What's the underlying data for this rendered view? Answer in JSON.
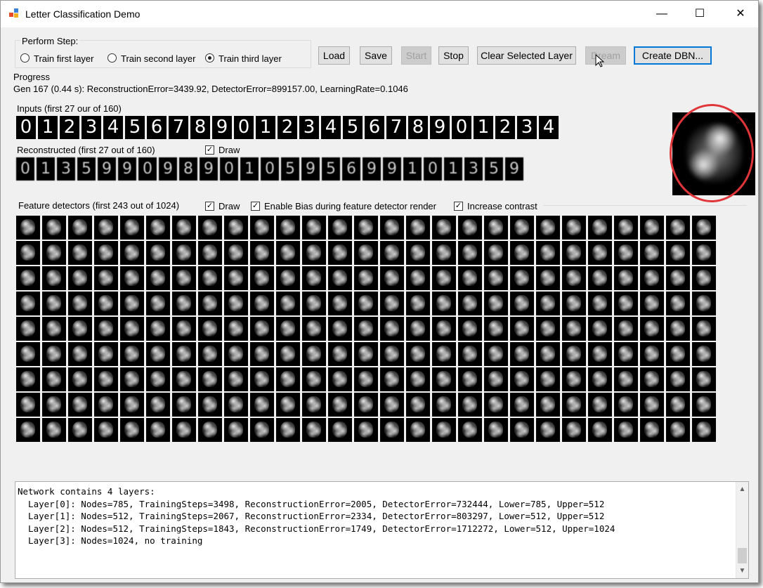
{
  "window": {
    "title": "Letter Classification Demo",
    "min_glyph": "—",
    "max_glyph": "☐",
    "close_glyph": "✕"
  },
  "perform_step": {
    "legend": "Perform Step:",
    "options": [
      {
        "label": "Train first layer",
        "selected": false
      },
      {
        "label": "Train second layer",
        "selected": false
      },
      {
        "label": "Train third layer",
        "selected": true
      }
    ]
  },
  "toolbar": {
    "load": "Load",
    "save": "Save",
    "start": "Start",
    "stop": "Stop",
    "clear_selected_layer": "Clear Selected Layer",
    "dream": "Dream",
    "create_dbn": "Create DBN..."
  },
  "progress": {
    "label": "Progress",
    "status": "Gen 167 (0.44 s): ReconstructionError=3439.92, DetectorError=899157.00, LearningRate=0.1046"
  },
  "inputs": {
    "label": "Inputs (first 27 our of 160)",
    "digits": [
      "0",
      "1",
      "2",
      "3",
      "4",
      "5",
      "6",
      "7",
      "8",
      "9",
      "0",
      "1",
      "2",
      "3",
      "4",
      "5",
      "6",
      "7",
      "8",
      "9",
      "0",
      "1",
      "2",
      "3",
      "4"
    ]
  },
  "reconstructed": {
    "label": "Reconstructed (first 27 out of 160)",
    "draw_label": "Draw",
    "draw_checked": true,
    "digits": [
      "0",
      "1",
      "3",
      "5",
      "9",
      "9",
      "0",
      "9",
      "8",
      "9",
      "0",
      "1",
      "0",
      "5",
      "9",
      "5",
      "6",
      "9",
      "9",
      "1",
      "0",
      "1",
      "3",
      "5",
      "9"
    ]
  },
  "feature_detectors": {
    "label": "Feature detectors (first 243 out of 1024)",
    "draw_label": "Draw",
    "draw_checked": true,
    "bias_label": "Enable Bias during feature detector render",
    "bias_checked": true,
    "contrast_label": "Increase contrast",
    "contrast_checked": true,
    "shown": 243
  },
  "log": {
    "lines": [
      "Network contains 4 layers:",
      "  Layer[0]: Nodes=785, TrainingSteps=3498, ReconstructionError=2005, DetectorError=732444, Lower=785, Upper=512",
      "  Layer[1]: Nodes=512, TrainingSteps=2067, ReconstructionError=2334, DetectorError=803297, Lower=512, Upper=512",
      "  Layer[2]: Nodes=512, TrainingSteps=1843, ReconstructionError=1749, DetectorError=1712272, Lower=512, Upper=1024",
      "  Layer[3]: Nodes=1024, no training"
    ],
    "scroll_up": "▲",
    "scroll_down": "▼"
  },
  "colors": {
    "highlight": "#e0363a",
    "default_button_border": "#0078d7",
    "window_bg": "#f0f0f0"
  }
}
